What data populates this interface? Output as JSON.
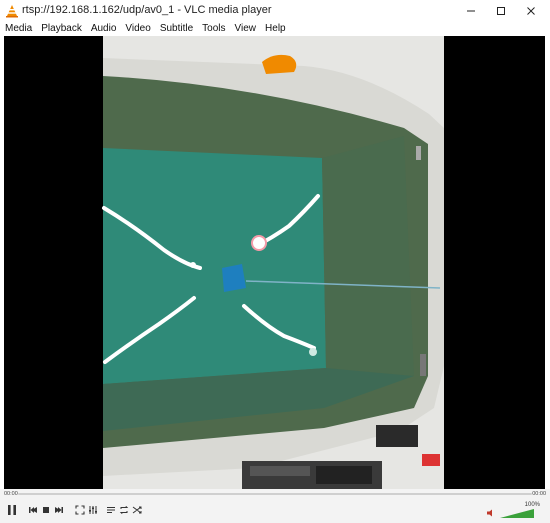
{
  "window": {
    "title": "rtsp://192.168.1.162/udp/av0_1 - VLC media player",
    "app_icon": "vlc-cone-icon"
  },
  "menu": [
    {
      "label": "Media"
    },
    {
      "label": "Playback"
    },
    {
      "label": "Audio"
    },
    {
      "label": "Video"
    },
    {
      "label": "Subtitle"
    },
    {
      "label": "Tools"
    },
    {
      "label": "View"
    },
    {
      "label": "Help"
    }
  ],
  "playback": {
    "time_elapsed": "00:00",
    "time_total": "00:00",
    "progress_fraction": 0.0
  },
  "volume": {
    "label": "100%",
    "level_fraction": 1.0
  },
  "colors": {
    "accent_orange": "#f08a00",
    "volume_green": "#3aa13a",
    "water": "#2f8a78"
  }
}
